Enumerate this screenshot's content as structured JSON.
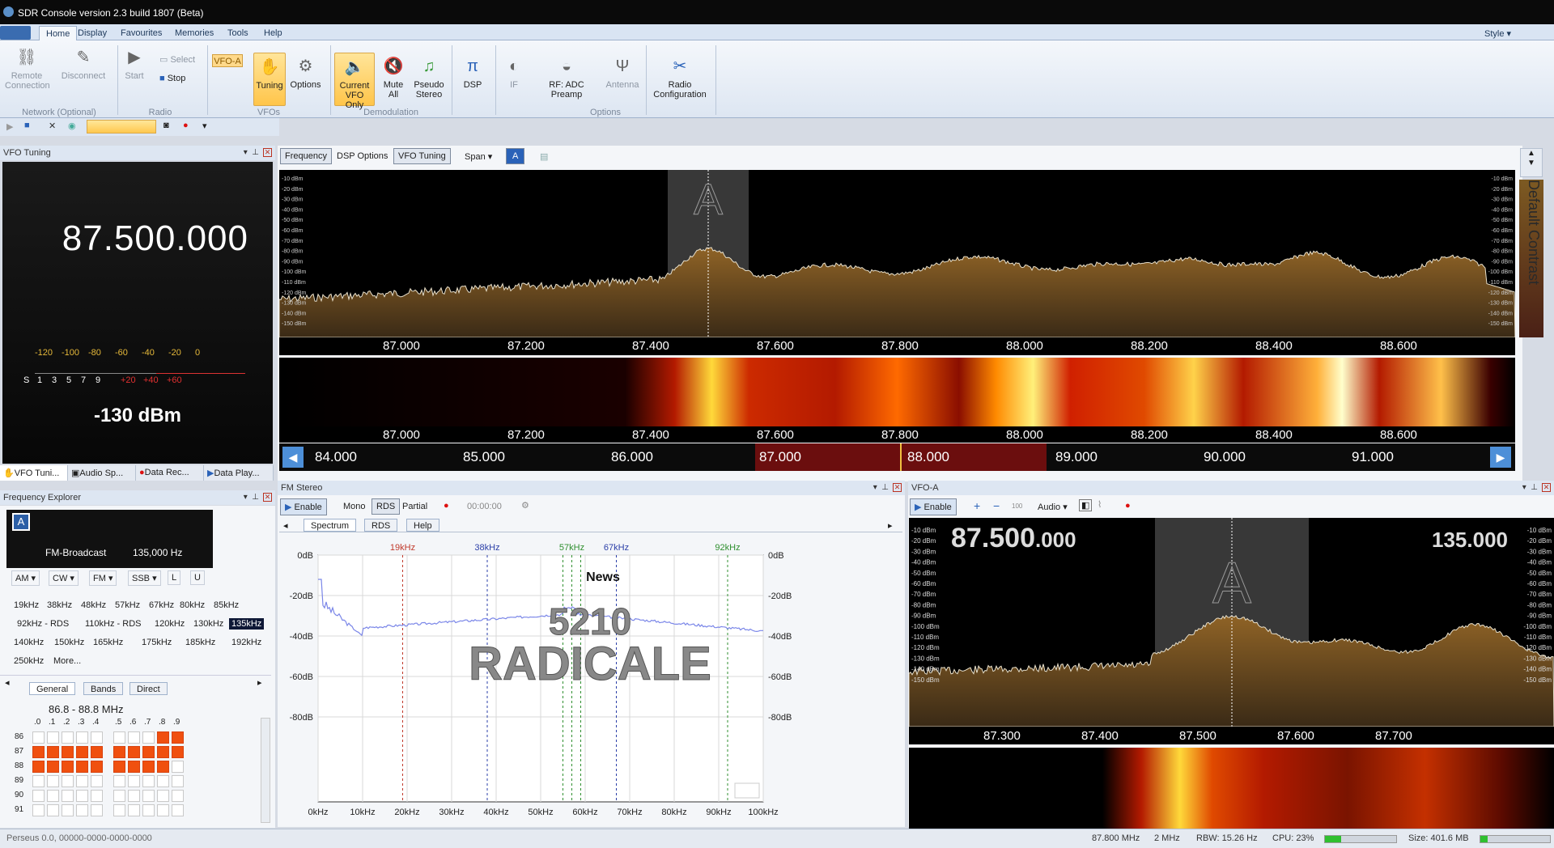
{
  "window": {
    "title": "SDR Console version 2.3 build 1807 (Beta)"
  },
  "ribbon": {
    "tabs": [
      "Home",
      "Display",
      "Favourites",
      "Memories",
      "Tools",
      "Help"
    ],
    "style_label": "Style",
    "groups": {
      "network": "Network (Optional)",
      "radio": "Radio",
      "vfos": "VFOs",
      "demodulation": "Demodulation",
      "options": "Options"
    },
    "buttons": {
      "remote_connection": "Remote Connection",
      "disconnect": "Disconnect",
      "start": "Start",
      "select": "Select",
      "stop": "Stop",
      "vfo_a": "VFO-A",
      "tuning": "Tuning",
      "options": "Options",
      "current_vfo_only": "Current VFO Only",
      "mute_all": "Mute All",
      "pseudo_stereo": "Pseudo Stereo",
      "dsp": "DSP",
      "if": "IF",
      "rf_adc_preamp": "RF: ADC Preamp",
      "antenna": "Antenna",
      "radio_configuration": "Radio Configuration"
    }
  },
  "vfo_tuning_panel": {
    "title": "VFO Tuning",
    "frequency": "87.500.000",
    "scale_top": [
      "-120",
      "-100",
      "-80",
      "-60",
      "-40",
      "-20",
      "0"
    ],
    "scale_bottom": [
      "S",
      "1",
      "3",
      "5",
      "7",
      "9",
      "+20",
      "+40",
      "+60"
    ],
    "signal": "-130 dBm"
  },
  "left_tabs": [
    "VFO Tuni...",
    "Audio Sp...",
    "Data Rec...",
    "Data Play..."
  ],
  "frequency_explorer": {
    "title": "Frequency Explorer",
    "badge": "A",
    "band": "FM-Broadcast",
    "bandwidth": "135,000 Hz",
    "modes": [
      "AM",
      "CW",
      "FM",
      "SSB",
      "L",
      "U"
    ],
    "filters": [
      "19kHz",
      "38kHz",
      "48kHz",
      "57kHz",
      "67kHz",
      "80kHz",
      "85kHz",
      "92kHz - RDS",
      "110kHz - RDS",
      "120kHz",
      "130kHz",
      "135kHz",
      "140kHz",
      "150kHz",
      "165kHz",
      "175kHz",
      "185kHz",
      "192kHz",
      "250kHz",
      "More..."
    ],
    "selected_filter": "135kHz",
    "subtabs": [
      "General",
      "Bands",
      "Direct"
    ],
    "range": "86.8 - 88.8 MHz",
    "col_labels": [
      ".0",
      ".1",
      ".2",
      ".3",
      ".4",
      ".5",
      ".6",
      ".7",
      ".8",
      ".9"
    ],
    "row_labels": [
      "86",
      "87",
      "88",
      "89",
      "90",
      "91"
    ],
    "grid_on": [
      [
        0,
        0,
        0,
        0,
        0,
        0,
        0,
        0,
        1,
        1
      ],
      [
        1,
        1,
        1,
        1,
        1,
        1,
        1,
        1,
        1,
        1
      ],
      [
        1,
        1,
        1,
        1,
        1,
        1,
        1,
        1,
        1,
        0
      ],
      [
        0,
        0,
        0,
        0,
        0,
        0,
        0,
        0,
        0,
        0
      ],
      [
        0,
        0,
        0,
        0,
        0,
        0,
        0,
        0,
        0,
        0
      ],
      [
        0,
        0,
        0,
        0,
        0,
        0,
        0,
        0,
        0,
        0
      ]
    ]
  },
  "spectrum_toolbar": {
    "frequency": "Frequency",
    "dsp_options": "DSP Options",
    "vfo_tuning": "VFO Tuning",
    "span": "Span",
    "badge": "A"
  },
  "main_spectrum": {
    "db_labels": [
      "-10 dBm",
      "-20 dBm",
      "-30 dBm",
      "-40 dBm",
      "-50 dBm",
      "-60 dBm",
      "-70 dBm",
      "-80 dBm",
      "-90 dBm",
      "-100 dBm",
      "-110 dBm",
      "-120 dBm",
      "-130 dBm",
      "-140 dBm",
      "-150 dBm"
    ],
    "freq_ticks": [
      "87.000",
      "87.200",
      "87.400",
      "87.600",
      "87.800",
      "88.000",
      "88.200",
      "88.400",
      "88.600"
    ],
    "vfo_label": "A",
    "contrast_label": "Default Contrast"
  },
  "band_strip": {
    "ticks": [
      "84.000",
      "85.000",
      "86.000",
      "87.000",
      "88.000",
      "89.000",
      "90.000",
      "91.000"
    ]
  },
  "fm_stereo": {
    "title": "FM Stereo",
    "enable": "Enable",
    "mono": "Mono",
    "rds": "RDS",
    "partial": "Partial",
    "time": "00:00:00",
    "tabs": [
      "Spectrum",
      "RDS",
      "Help"
    ],
    "markers": [
      "19kHz",
      "38kHz",
      "57kHz",
      "67kHz",
      "92kHz"
    ],
    "y_labels": [
      "0dB",
      "-20dB",
      "-40dB",
      "-60dB",
      "-80dB"
    ],
    "x_labels": [
      "0kHz",
      "10kHz",
      "20kHz",
      "30kHz",
      "40kHz",
      "50kHz",
      "60kHz",
      "70kHz",
      "80kHz",
      "90kHz",
      "100kHz"
    ],
    "rds_pty": "News",
    "rds_pi": "5210",
    "rds_ps": "RADICALE"
  },
  "vfo_a_panel": {
    "title": "VFO-A",
    "enable": "Enable",
    "hundred": "100",
    "audio": "Audio",
    "freq_main": "87.500",
    "freq_sub": ".000",
    "bandwidth": "135.000",
    "vfo_label": "A",
    "db_labels": [
      "-10 dBm",
      "-20 dBm",
      "-30 dBm",
      "-40 dBm",
      "-50 dBm",
      "-60 dBm",
      "-70 dBm",
      "-80 dBm",
      "-90 dBm",
      "-100 dBm",
      "-110 dBm",
      "-120 dBm",
      "-130 dBm",
      "-140 dBm",
      "-150 dBm"
    ],
    "freq_ticks": [
      "87.300",
      "87.400",
      "87.500",
      "87.600",
      "87.700"
    ]
  },
  "status": {
    "device": "Perseus 0.0, 00000-0000-0000-0000",
    "freq": "87.800 MHz",
    "bw": "2 MHz",
    "rbw": "RBW: 15.26 Hz",
    "cpu": "CPU: 23%",
    "cpu_level": 0.23,
    "size": "Size: 401.6 MB"
  }
}
